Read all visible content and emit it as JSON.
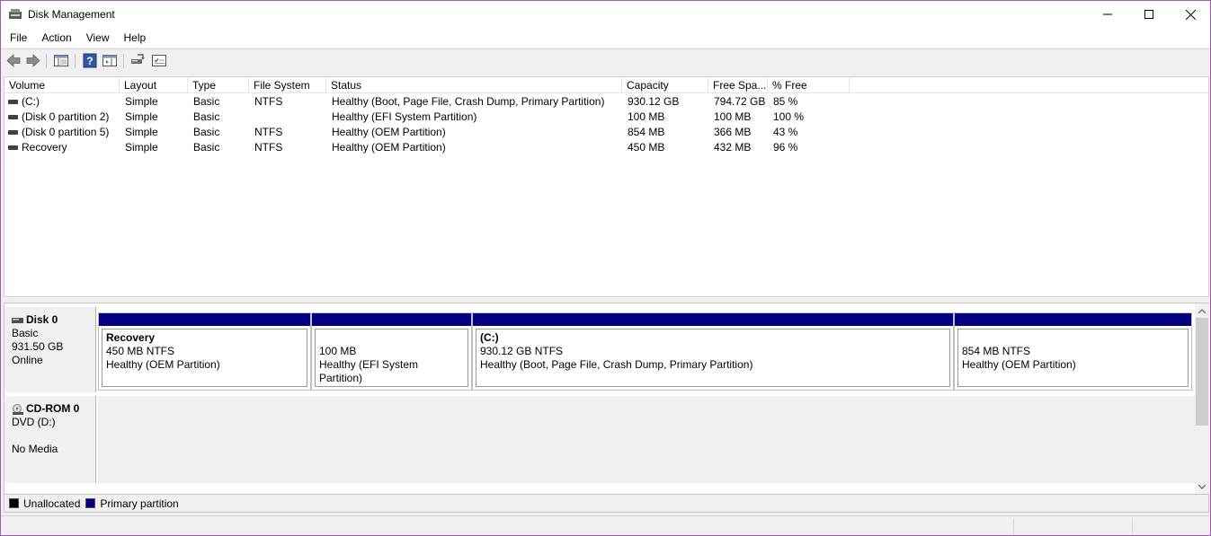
{
  "window": {
    "title": "Disk Management",
    "icon": "disk-management-icon"
  },
  "menu": [
    {
      "label": "File"
    },
    {
      "label": "Action"
    },
    {
      "label": "View"
    },
    {
      "label": "Help"
    }
  ],
  "toolbar": {
    "buttons": [
      "back-icon",
      "forward-icon",
      "show-hide-tree-icon",
      "help-icon",
      "show-hide-action-pane-icon",
      "connect-disk-icon",
      "properties-icon"
    ]
  },
  "volume_list": {
    "columns": [
      "Volume",
      "Layout",
      "Type",
      "File System",
      "Status",
      "Capacity",
      "Free Spa...",
      "% Free"
    ],
    "rows": [
      {
        "volume": " (C:)",
        "layout": "Simple",
        "type": "Basic",
        "fs": "NTFS",
        "status": "Healthy (Boot, Page File, Crash Dump, Primary Partition)",
        "capacity": "930.12 GB",
        "free": "794.72 GB",
        "pct": "85 %"
      },
      {
        "volume": "(Disk 0 partition 2)",
        "layout": "Simple",
        "type": "Basic",
        "fs": "",
        "status": "Healthy (EFI System Partition)",
        "capacity": "100 MB",
        "free": "100 MB",
        "pct": "100 %"
      },
      {
        "volume": "(Disk 0 partition 5)",
        "layout": "Simple",
        "type": "Basic",
        "fs": "NTFS",
        "status": "Healthy (OEM Partition)",
        "capacity": "854 MB",
        "free": "366 MB",
        "pct": "43 %"
      },
      {
        "volume": "Recovery",
        "layout": "Simple",
        "type": "Basic",
        "fs": "NTFS",
        "status": "Healthy (OEM Partition)",
        "capacity": "450 MB",
        "free": "432 MB",
        "pct": "96 %"
      }
    ]
  },
  "disks": {
    "disk0": {
      "name": "Disk 0",
      "type": "Basic",
      "size": "931.50 GB",
      "state": "Online",
      "partitions": [
        {
          "title": "Recovery",
          "size": "450 MB NTFS",
          "status": "Healthy (OEM Partition)"
        },
        {
          "title": "",
          "size": "100 MB",
          "status": "Healthy (EFI System Partition)"
        },
        {
          "title": " (C:)",
          "size": "930.12 GB NTFS",
          "status": "Healthy (Boot, Page File, Crash Dump, Primary Partition)"
        },
        {
          "title": "",
          "size": "854 MB NTFS",
          "status": "Healthy (OEM Partition)"
        }
      ]
    },
    "cdrom0": {
      "name": "CD-ROM 0",
      "type": "DVD (D:)",
      "media": "No Media"
    }
  },
  "legend": [
    {
      "label": "Unallocated",
      "color": "#000000"
    },
    {
      "label": "Primary partition",
      "color": "#000080"
    }
  ],
  "colors": {
    "primary_partition": "#000080",
    "window_border": "#a15bb3"
  }
}
